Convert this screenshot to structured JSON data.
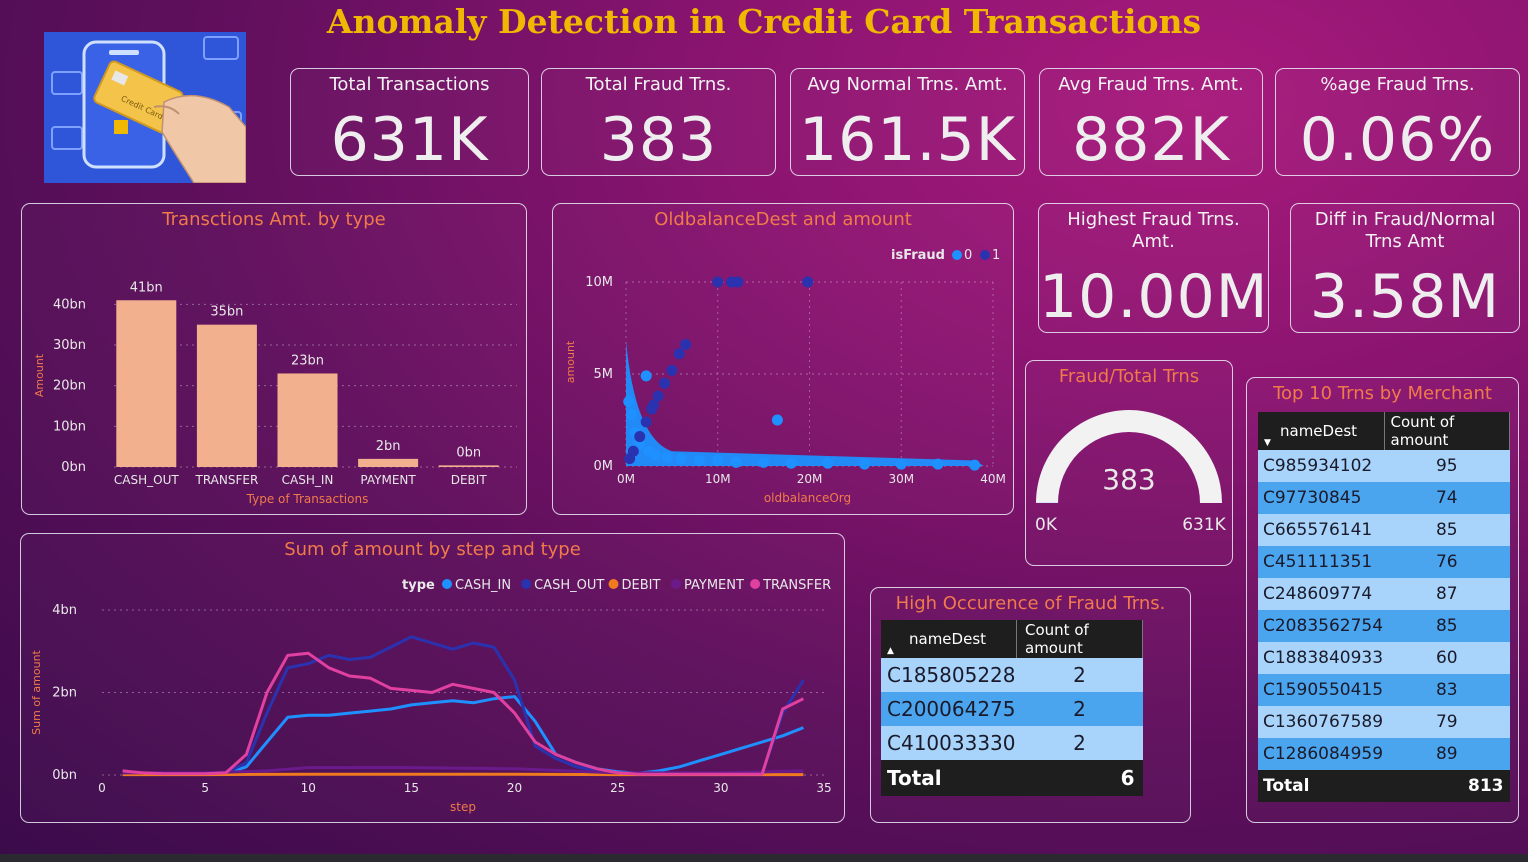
{
  "title": "Anomaly Detection in Credit Card Transactions",
  "logo": {
    "label": "Credit Card"
  },
  "kpis": [
    {
      "label": "Total Transactions",
      "value": "631K"
    },
    {
      "label": "Total Fraud Trns.",
      "value": "383"
    },
    {
      "label": "Avg Normal Trns. Amt.",
      "value": "161.5K"
    },
    {
      "label": "Avg Fraud Trns. Amt.",
      "value": "882K"
    },
    {
      "label": "%age Fraud Trns.",
      "value": "0.06%"
    },
    {
      "label": "Highest Fraud Trns. Amt.",
      "value": "10.00M"
    },
    {
      "label": "Diff in Fraud/Normal Trns Amt",
      "value": "3.58M"
    }
  ],
  "colors": {
    "title": "#f0b800",
    "panel_title": "#f07a4a",
    "bar": "#f3b08e",
    "cash_in": "#1e90ff",
    "cash_out": "#2a32b0",
    "debit": "#f07a20",
    "payment": "#6a1a8a",
    "transfer": "#e040a0",
    "fraud0": "#1e90ff",
    "fraud1": "#2a32b0",
    "row_light": "#a8d4fb",
    "row_dark": "#4aa4ee"
  },
  "chart_data": [
    {
      "type": "bar",
      "title": "Transctions Amt. by type",
      "xlabel": "Type of Transactions",
      "ylabel": "Amount",
      "categories": [
        "CASH_OUT",
        "TRANSFER",
        "CASH_IN",
        "PAYMENT",
        "DEBIT"
      ],
      "values": [
        41,
        35,
        23,
        2,
        0.4
      ],
      "data_labels": [
        "41bn",
        "35bn",
        "23bn",
        "2bn",
        "0bn"
      ],
      "yticks": [
        "0bn",
        "10bn",
        "20bn",
        "30bn",
        "40bn"
      ],
      "ylim": [
        0,
        45
      ]
    },
    {
      "type": "scatter",
      "title": "OldbalanceDest and amount",
      "xlabel": "oldbalanceOrg",
      "ylabel": "amount",
      "legend_title": "isFraud",
      "legend": [
        "0",
        "1"
      ],
      "xticks": [
        "0M",
        "10M",
        "20M",
        "30M",
        "40M"
      ],
      "yticks": [
        "0M",
        "5M",
        "10M"
      ],
      "xlim": [
        0,
        40
      ],
      "ylim": [
        0,
        10
      ],
      "series": [
        {
          "name": "0",
          "points": [
            [
              1.5,
              1.2
            ],
            [
              2.5,
              0.8
            ],
            [
              3.2,
              0.6
            ],
            [
              4.5,
              0.5
            ],
            [
              6,
              0.4
            ],
            [
              8,
              0.3
            ],
            [
              10,
              0.3
            ],
            [
              12,
              0.2
            ],
            [
              15,
              0.2
            ],
            [
              18,
              0.15
            ],
            [
              22,
              0.15
            ],
            [
              26,
              0.1
            ],
            [
              30,
              0.1
            ],
            [
              34,
              0.1
            ],
            [
              38,
              0.05
            ],
            [
              2.2,
              4.9
            ],
            [
              16.5,
              2.5
            ],
            [
              0.3,
              3.5
            ],
            [
              0.6,
              2.8
            ],
            [
              1,
              1.8
            ]
          ]
        },
        {
          "name": "1",
          "points": [
            [
              0.8,
              0.8
            ],
            [
              1.5,
              1.6
            ],
            [
              2.2,
              2.4
            ],
            [
              2.8,
              3.1
            ],
            [
              3.5,
              3.8
            ],
            [
              4.2,
              4.5
            ],
            [
              5,
              5.2
            ],
            [
              5.8,
              6.1
            ],
            [
              6.5,
              6.6
            ],
            [
              10,
              10
            ],
            [
              11.5,
              10
            ],
            [
              12.2,
              10
            ],
            [
              19.8,
              10
            ],
            [
              0.4,
              0.4
            ],
            [
              3.0,
              3.3
            ]
          ]
        }
      ]
    },
    {
      "type": "line",
      "title": "Sum of amount by step and type",
      "xlabel": "step",
      "ylabel": "Sum of amount",
      "legend_title": "type",
      "xticks": [
        "0",
        "5",
        "10",
        "15",
        "20",
        "25",
        "30",
        "35"
      ],
      "yticks": [
        "0bn",
        "2bn",
        "4bn"
      ],
      "xlim": [
        0,
        35
      ],
      "ylim": [
        0,
        4
      ],
      "series": [
        {
          "name": "CASH_IN",
          "x": [
            1,
            2,
            3,
            4,
            5,
            6,
            7,
            8,
            9,
            10,
            11,
            12,
            13,
            14,
            15,
            16,
            17,
            18,
            19,
            20,
            21,
            22,
            23,
            24,
            25,
            26,
            27,
            28,
            29,
            30,
            31,
            32,
            33,
            34
          ],
          "values": [
            0.05,
            0.03,
            0.02,
            0.02,
            0.02,
            0.03,
            0.2,
            0.8,
            1.4,
            1.45,
            1.45,
            1.5,
            1.55,
            1.6,
            1.7,
            1.75,
            1.8,
            1.75,
            1.85,
            1.9,
            1.3,
            0.5,
            0.3,
            0.15,
            0.08,
            0.04,
            0.1,
            0.2,
            0.35,
            0.5,
            0.65,
            0.8,
            0.95,
            1.15
          ]
        },
        {
          "name": "CASH_OUT",
          "x": [
            1,
            2,
            3,
            4,
            5,
            6,
            7,
            8,
            9,
            10,
            11,
            12,
            13,
            14,
            15,
            16,
            17,
            18,
            19,
            20,
            21,
            22,
            23,
            24,
            25,
            26,
            27,
            28,
            29,
            30,
            31,
            32,
            33,
            34
          ],
          "values": [
            0.08,
            0.05,
            0.03,
            0.03,
            0.03,
            0.05,
            0.3,
            1.5,
            2.6,
            2.7,
            2.9,
            2.8,
            2.85,
            3.1,
            3.35,
            3.2,
            3.05,
            3.2,
            3.1,
            2.3,
            0.7,
            0.4,
            0.2,
            0.1,
            0.05,
            0.02,
            0.02,
            0.02,
            0.02,
            0.02,
            0.02,
            0.02,
            1.5,
            2.3
          ]
        },
        {
          "name": "DEBIT",
          "x": [
            1,
            5,
            10,
            15,
            20,
            25,
            30,
            34
          ],
          "values": [
            0.01,
            0.01,
            0.02,
            0.02,
            0.02,
            0.01,
            0.01,
            0.01
          ]
        },
        {
          "name": "PAYMENT",
          "x": [
            1,
            5,
            8,
            10,
            15,
            20,
            25,
            30,
            34
          ],
          "values": [
            0.05,
            0.05,
            0.1,
            0.18,
            0.18,
            0.15,
            0.05,
            0.05,
            0.1
          ]
        },
        {
          "name": "TRANSFER",
          "x": [
            1,
            2,
            3,
            4,
            5,
            6,
            7,
            8,
            9,
            10,
            11,
            12,
            13,
            14,
            15,
            16,
            17,
            18,
            19,
            20,
            21,
            22,
            23,
            24,
            25,
            26,
            27,
            28,
            29,
            30,
            31,
            32,
            33,
            34
          ],
          "values": [
            0.1,
            0.05,
            0.03,
            0.03,
            0.03,
            0.05,
            0.5,
            2.0,
            2.9,
            2.95,
            2.6,
            2.4,
            2.35,
            2.1,
            2.05,
            2.0,
            2.2,
            2.1,
            2.0,
            1.5,
            0.8,
            0.5,
            0.3,
            0.15,
            0.05,
            0.02,
            0.02,
            0.02,
            0.02,
            0.02,
            0.02,
            0.02,
            1.6,
            1.85
          ]
        }
      ]
    },
    {
      "type": "gauge",
      "title": "Fraud/Total Trns",
      "value": 383,
      "value_label": "383",
      "min_label": "0K",
      "max_label": "631K",
      "min": 0,
      "max": 631000
    }
  ],
  "fraud_table": {
    "title": "High Occurence of Fraud Trns.",
    "headers": [
      "nameDest",
      "Count of amount"
    ],
    "rows": [
      [
        "C185805228",
        "2"
      ],
      [
        "C200064275",
        "2"
      ],
      [
        "C410033330",
        "2"
      ]
    ],
    "total": [
      "Total",
      "6"
    ]
  },
  "merchant_table": {
    "title": "Top 10 Trns by Merchant",
    "headers": [
      "nameDest",
      "Count of amount"
    ],
    "rows": [
      [
        "C985934102",
        "95"
      ],
      [
        "C97730845",
        "74"
      ],
      [
        "C665576141",
        "85"
      ],
      [
        "C451111351",
        "76"
      ],
      [
        "C248609774",
        "87"
      ],
      [
        "C2083562754",
        "85"
      ],
      [
        "C1883840933",
        "60"
      ],
      [
        "C1590550415",
        "83"
      ],
      [
        "C1360767589",
        "79"
      ],
      [
        "C1286084959",
        "89"
      ]
    ],
    "total": [
      "Total",
      "813"
    ]
  }
}
